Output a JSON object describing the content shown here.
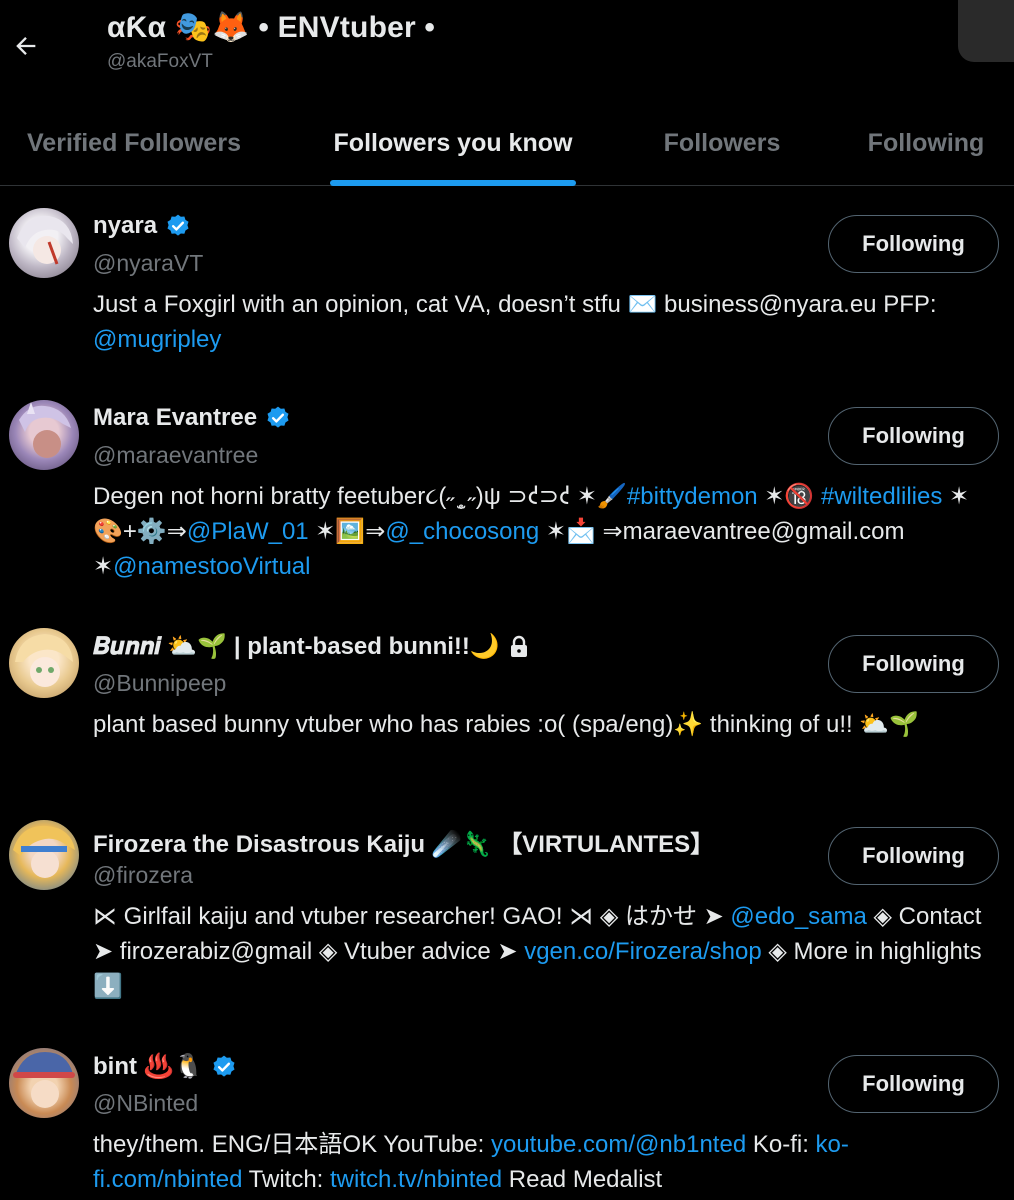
{
  "header": {
    "title": "αƘα 🎭🦊 • ENVtuber •",
    "handle": "@akaFoxVT"
  },
  "tabs": [
    {
      "label": "Verified Followers",
      "active": false
    },
    {
      "label": "Followers you know",
      "active": true
    },
    {
      "label": "Followers",
      "active": false
    },
    {
      "label": "Following",
      "active": false
    }
  ],
  "users": [
    {
      "name": "nyara",
      "verified": true,
      "handle": "@nyaraVT",
      "button": "Following",
      "bio_parts": [
        {
          "text": "Just a Foxgirl with an opinion, cat VA, doesn’t stfu ✉️ business@nyara.eu PFP: "
        },
        {
          "text": "@mugripley",
          "link": true
        }
      ]
    },
    {
      "name": "Mara Evantree",
      "verified": true,
      "handle": "@maraevantree",
      "button": "Following",
      "bio_parts": [
        {
          "text": "Degen not horni bratty feetuber૮(˶ ̫̥ ˶)ψ ⊃𐑒⊃𐑒 ✶🖌️"
        },
        {
          "text": "#bittydemon",
          "link": true
        },
        {
          "text": " ✶🔞 "
        },
        {
          "text": "#wiltedlilies",
          "link": true
        },
        {
          "text": " ✶🎨+⚙️⇒"
        },
        {
          "text": "@PlaW_01",
          "link": true
        },
        {
          "text": " ✶🖼️⇒"
        },
        {
          "text": "@_chocosong",
          "link": true
        },
        {
          "text": " ✶📩 ⇒maraevantree@gmail.com ✶"
        },
        {
          "text": "@namestooVirtual",
          "link": true
        }
      ]
    },
    {
      "name": "𝑩𝒖𝒏𝒏𝒊 ⛅🌱 | plant-based bunni!!🌙",
      "verified": false,
      "locked": true,
      "handle": "@Bunnipeep",
      "button": "Following",
      "bio_parts": [
        {
          "text": "plant based bunny vtuber who has rabies :o( (spa/eng)✨ thinking of u!! ⛅🌱"
        }
      ]
    },
    {
      "name": "Firozera the Disastrous Kaiju ☄️🦎 【VIRTULANTES】",
      "verified": false,
      "handle": "@firozera",
      "button": "Following",
      "bio_parts": [
        {
          "text": "⋉ Girlfail kaiju and vtuber researcher! GAO! ⋊ ◈ はかせ ➤ "
        },
        {
          "text": "@edo_sama",
          "link": true
        },
        {
          "text": " ◈ Contact ➤ firozerabiz@gmail ◈ Vtuber advice ➤ "
        },
        {
          "text": "vgen.co/Firozera/shop",
          "link": true
        },
        {
          "text": " ◈ More in highlights ⬇️"
        }
      ]
    },
    {
      "name": "bint ♨️🐧",
      "verified": true,
      "handle": "@NBinted",
      "button": "Following",
      "bio_parts": [
        {
          "text": "they/them. ENG/日本語OK YouTube: "
        },
        {
          "text": "youtube.com/@nb1nted",
          "link": true
        },
        {
          "text": " Ko-fi: "
        },
        {
          "text": "ko-fi.com/nbinted",
          "link": true
        },
        {
          "text": " Twitch: "
        },
        {
          "text": "twitch.tv/nbinted",
          "link": true
        },
        {
          "text": " Read Medalist"
        }
      ]
    }
  ],
  "colors": {
    "background": "#000000",
    "text": "#e7e9ea",
    "muted": "#71767b",
    "accent": "#1d9bf0"
  },
  "icons": {
    "back": "arrow-left-icon",
    "verified": "verified-badge-icon",
    "lock": "lock-icon"
  }
}
